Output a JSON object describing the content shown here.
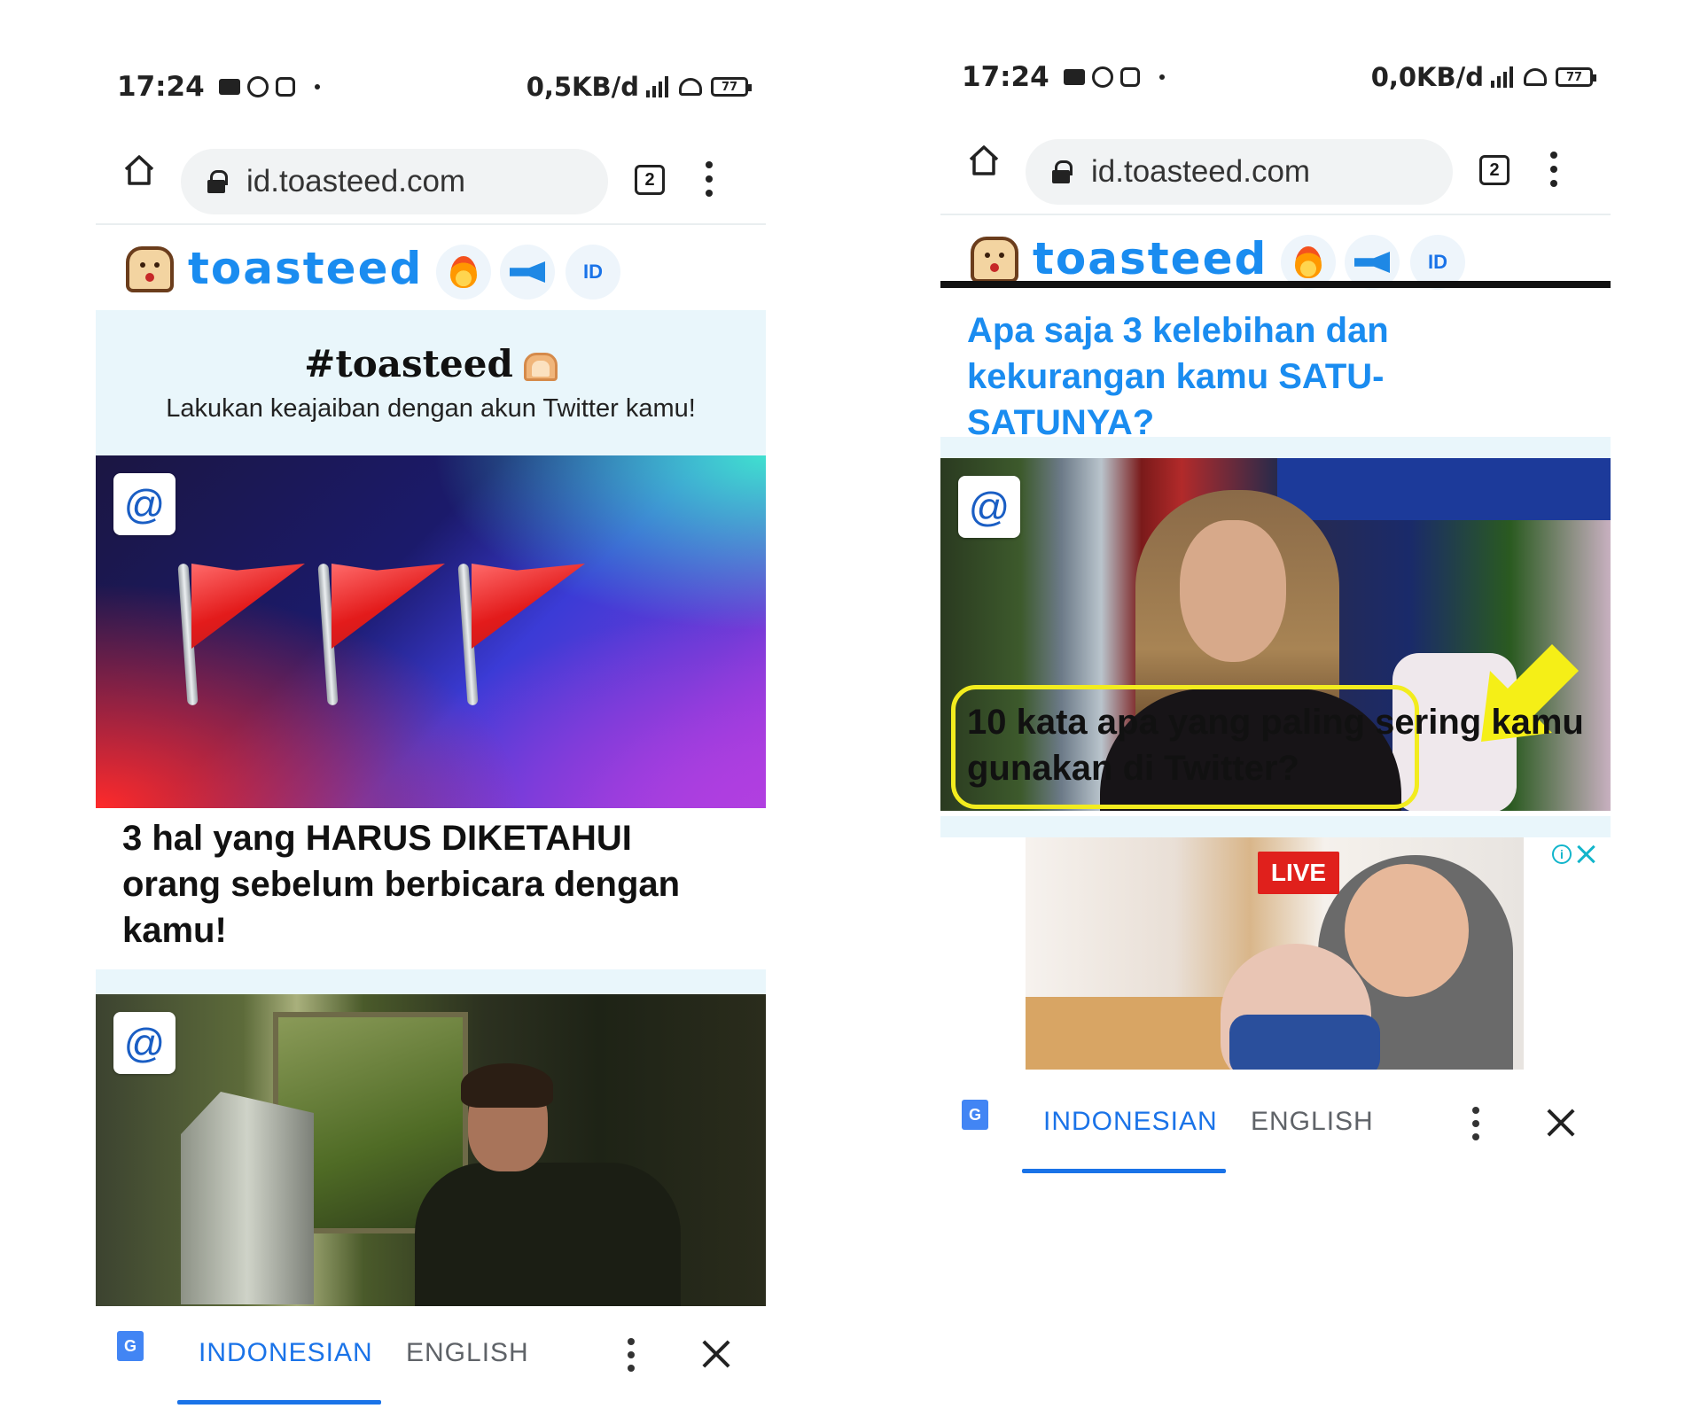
{
  "left": {
    "status": {
      "time": "17:24",
      "speed": "0,5KB/d",
      "battery": "77"
    },
    "browser": {
      "url": "id.toasteed.com",
      "tab_count": "2"
    },
    "site": {
      "brand": "toasteed",
      "lang_button": "ID"
    },
    "hero": {
      "title": "#toasteed",
      "subtitle": "Lakukan keajaiban dengan akun Twitter kamu!"
    },
    "cards": [
      {
        "badge": "@",
        "title": "3 hal yang HARUS DIKETAHUI orang sebelum berbicara dengan kamu!"
      },
      {
        "badge": "@"
      }
    ],
    "translate": {
      "active_lang": "INDONESIAN",
      "other_lang": "ENGLISH"
    }
  },
  "right": {
    "status": {
      "time": "17:24",
      "speed": "0,0KB/d",
      "battery": "77"
    },
    "browser": {
      "url": "id.toasteed.com",
      "tab_count": "2"
    },
    "site": {
      "brand": "toasteed",
      "lang_button": "ID"
    },
    "question": "Apa saja 3 kelebihan dan kekurangan kamu SATU-SATUNYA?",
    "cards": [
      {
        "badge": "@",
        "title": "10 kata apa yang paling sering kamu gunakan di Twitter?"
      }
    ],
    "ad": {
      "live_label": "LIVE",
      "info_glyph": "i"
    },
    "translate": {
      "active_lang": "INDONESIAN",
      "other_lang": "ENGLISH"
    }
  },
  "colors": {
    "brand_blue": "#1a8cf0",
    "translate_blue": "#1a73e8",
    "highlight_yellow": "#f2ec1e",
    "hero_bg": "#e9f6fb"
  }
}
